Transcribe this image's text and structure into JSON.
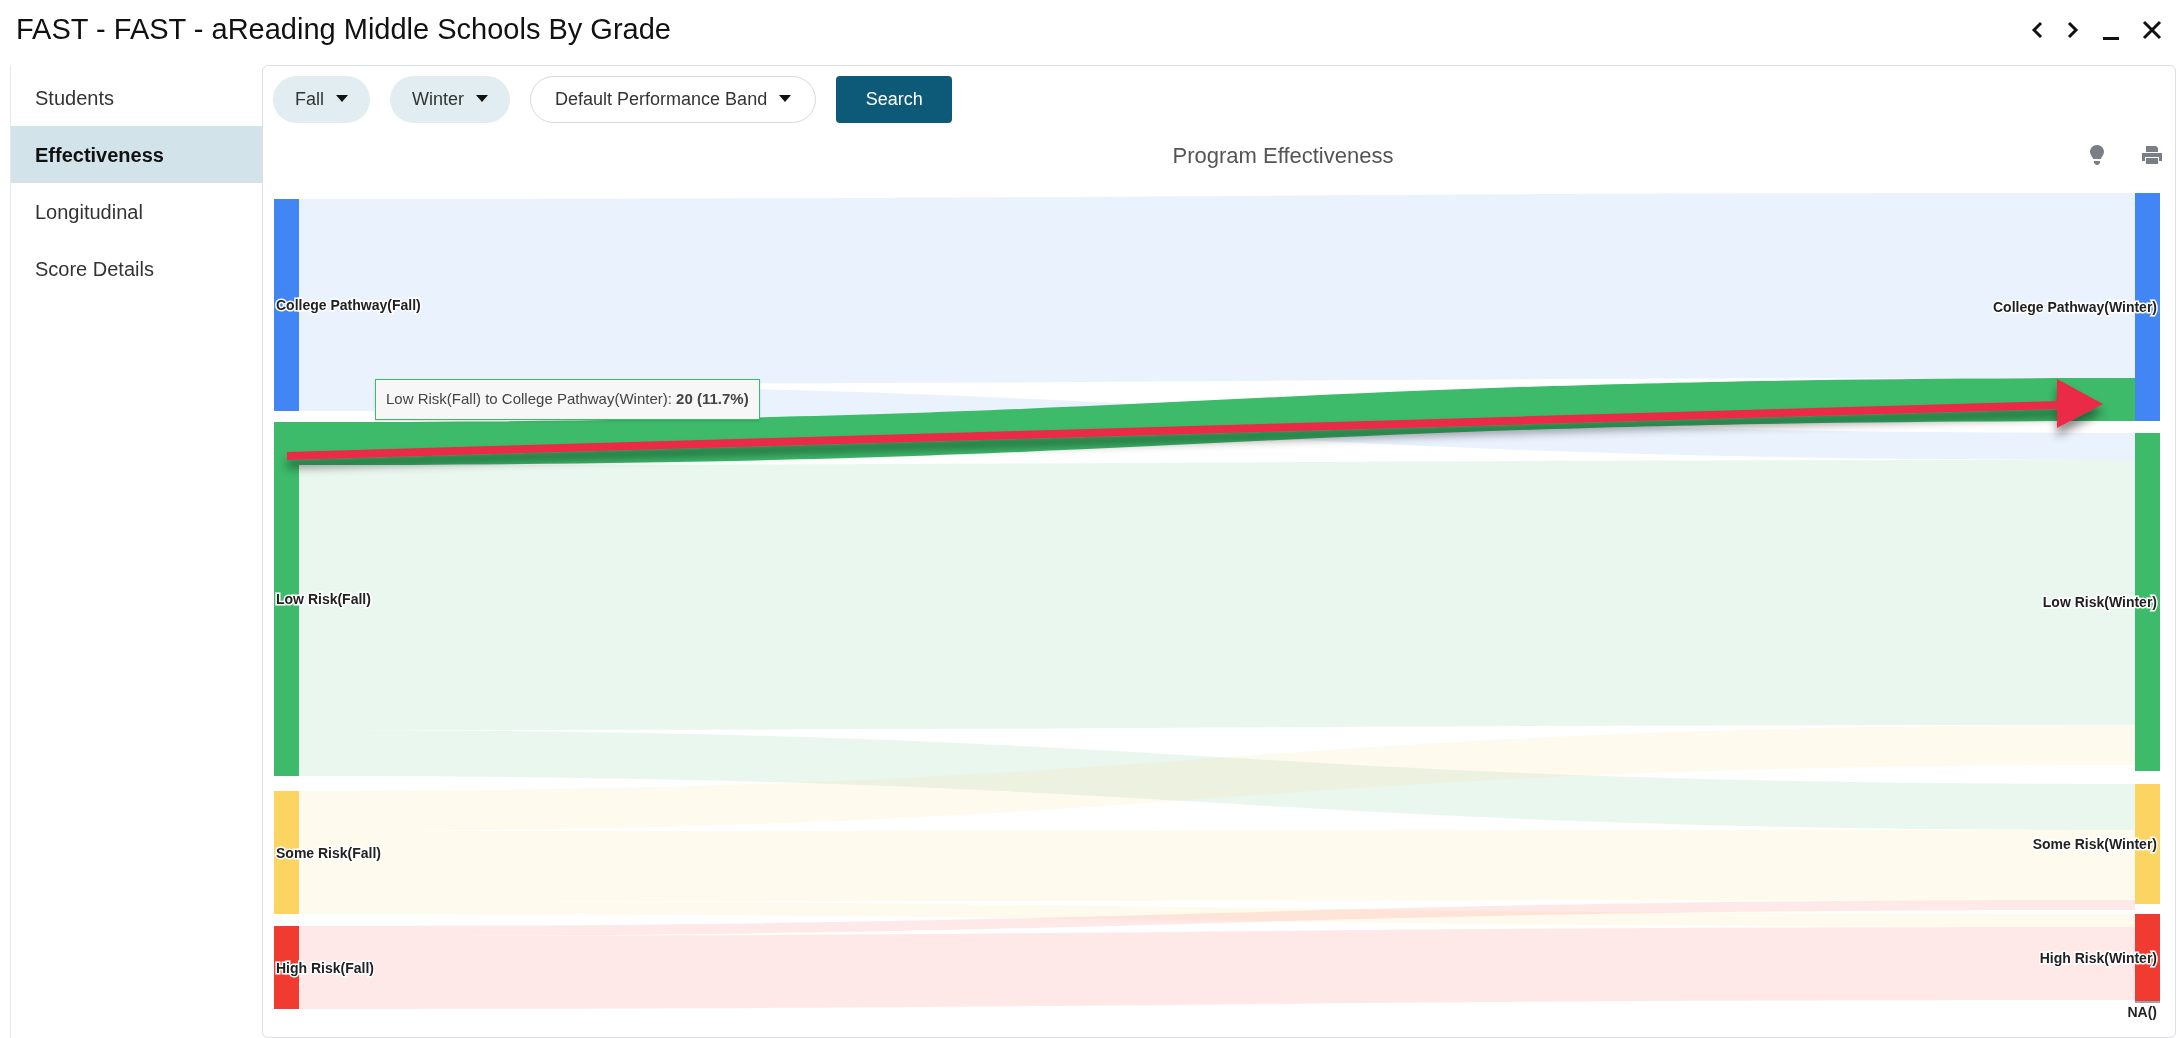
{
  "window": {
    "title": "FAST - FAST - aReading Middle Schools By Grade"
  },
  "sidebar": {
    "items": [
      {
        "label": "Students",
        "selected": false
      },
      {
        "label": "Effectiveness",
        "selected": true
      },
      {
        "label": "Longitudinal",
        "selected": false
      },
      {
        "label": "Score Details",
        "selected": false
      }
    ]
  },
  "filters": [
    {
      "kind": "pill",
      "label": "Fall"
    },
    {
      "kind": "pill",
      "label": "Winter"
    },
    {
      "kind": "outline",
      "label": "Default Performance Band"
    }
  ],
  "search_button": "Search",
  "chart": {
    "title": "Program Effectiveness",
    "left_nodes": [
      {
        "label": "College Pathway(Fall)",
        "color": "#4285f4"
      },
      {
        "label": "Low Risk(Fall)",
        "color": "#3dba6a"
      },
      {
        "label": "Some Risk(Fall)",
        "color": "#fbd462"
      },
      {
        "label": "High Risk(Fall)",
        "color": "#f23b30"
      }
    ],
    "right_nodes": [
      {
        "label": "College Pathway(Winter)",
        "color": "#4285f4"
      },
      {
        "label": "Low Risk(Winter)",
        "color": "#3dba6a"
      },
      {
        "label": "Some Risk(Winter)",
        "color": "#fbd462"
      },
      {
        "label": "High Risk(Winter)",
        "color": "#f23b30"
      },
      {
        "label": "NA()",
        "color": "#9ca3af"
      }
    ],
    "tooltip": "Low Risk(Fall) to College Pathway(Winter): **20 (11.7%)**"
  }
}
